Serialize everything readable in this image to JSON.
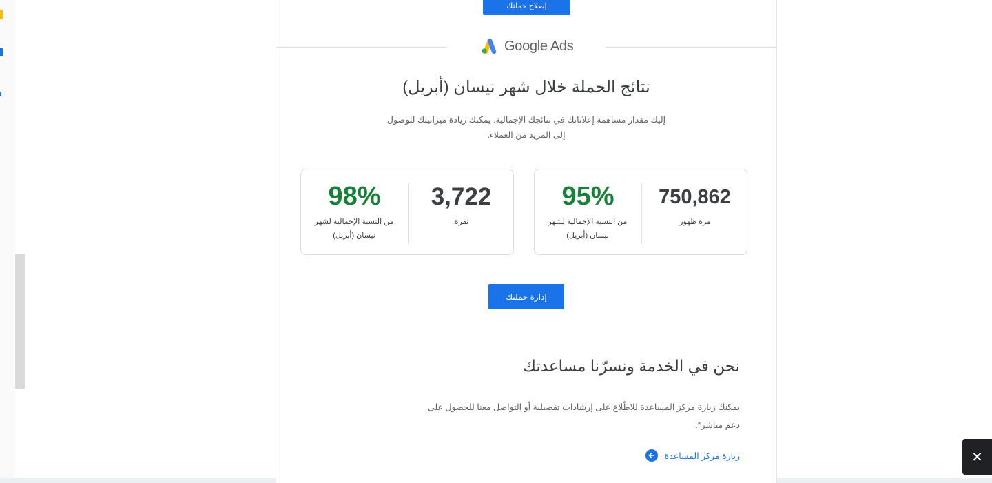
{
  "email": {
    "top_button_label": "إصلاح حملتك",
    "brand": {
      "name": "Google Ads",
      "colors": {
        "blue": "#4285f4",
        "yellow": "#fbbc04",
        "green": "#34a853"
      }
    },
    "title": "نتائج الحملة خلال شهر نيسان (أبريل)",
    "subtitle_line1": "إليك مقدار مساهمة إعلاناتك في نتائجك الإجمالية. يمكنك زيادة ميزانيتك للوصول",
    "subtitle_line2": "إلى المزيد من العملاء.",
    "cards": [
      {
        "value": "750,862",
        "value_label": "مرة ظهور",
        "percent": "95%",
        "percent_label_line1": "من النسبة الإجمالية لشهر",
        "percent_label_line2": "نيسان (أبريل)"
      },
      {
        "value": "3,722",
        "value_label": "نقرة",
        "percent": "98%",
        "percent_label_line1": "من النسبة الإجمالية لشهر",
        "percent_label_line2": "نيسان (أبريل)"
      }
    ],
    "manage_button_label": "إدارة حملتك",
    "help_heading": "نحن في الخدمة ونسرّنا مساعدتك",
    "help_para_line1": "يمكنك زيارة مركز المساعدة للاطّلاع على إرشادات تفصيلية أو التواصل معنا للحصول على",
    "help_para_line2": "دعم مباشر*.",
    "help_link_label": "زيارة مركز المساعدة"
  },
  "toast": {
    "close_symbol": "✕"
  },
  "colors": {
    "accent": "#1a73e8",
    "positive": "#188038",
    "text": "#3c4043"
  }
}
